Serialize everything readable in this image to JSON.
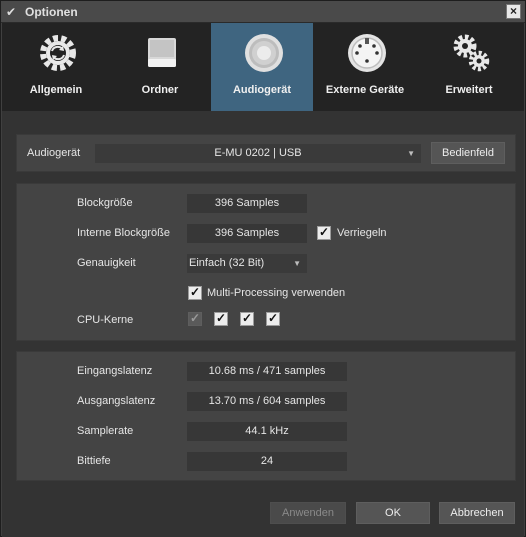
{
  "window": {
    "title": "Optionen",
    "close_glyph": "×"
  },
  "tabs": [
    {
      "label": "Allgemein",
      "icon": "gear-refresh-icon"
    },
    {
      "label": "Ordner",
      "icon": "drive-icon"
    },
    {
      "label": "Audiogerät",
      "icon": "speaker-icon"
    },
    {
      "label": "Externe Geräte",
      "icon": "midi-port-icon"
    },
    {
      "label": "Erweitert",
      "icon": "gears-icon"
    }
  ],
  "active_tab": "Audiogerät",
  "device": {
    "label": "Audiogerät",
    "selected": "E-MU 0202 | USB",
    "control_panel_button": "Bedienfeld"
  },
  "buffer": {
    "block_size_label": "Blockgröße",
    "block_size_value": "396 Samples",
    "internal_block_size_label": "Interne Blockgröße",
    "internal_block_size_value": "396 Samples",
    "lock_label": "Verriegeln",
    "lock_checked": true,
    "precision_label": "Genauigkeit",
    "precision_value": "Einfach (32 Bit)",
    "multiprocessing_label": "Multi-Processing verwenden",
    "multiprocessing_checked": true,
    "cpu_cores_label": "CPU-Kerne",
    "cpu_cores": [
      true,
      true,
      true,
      true
    ]
  },
  "info": {
    "input_latency_label": "Eingangslatenz",
    "input_latency_value": "10.68 ms / 471 samples",
    "output_latency_label": "Ausgangslatenz",
    "output_latency_value": "13.70 ms / 604 samples",
    "sample_rate_label": "Samplerate",
    "sample_rate_value": "44.1 kHz",
    "bit_depth_label": "Bittiefe",
    "bit_depth_value": "24"
  },
  "footer": {
    "apply": "Anwenden",
    "ok": "OK",
    "cancel": "Abbrechen"
  },
  "colors": {
    "active_tab": "#3f6580",
    "tabbar": "#232323",
    "panel": "#444444"
  }
}
